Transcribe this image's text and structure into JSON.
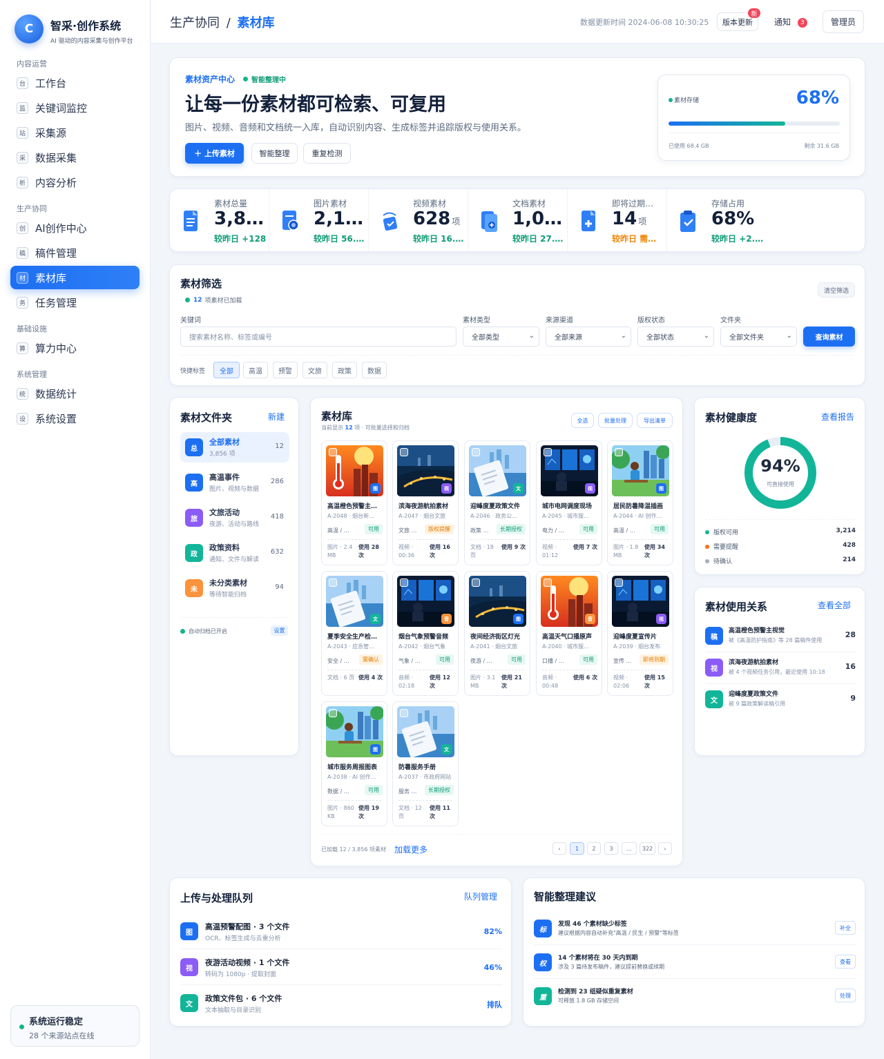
{
  "brand": {
    "logo": "C",
    "title": "智采·创作系统",
    "subtitle": "AI 驱动的内容采集与创作平台"
  },
  "nav": [
    {
      "group": "内容运营",
      "items": [
        {
          "icon": "台",
          "label": "工作台"
        },
        {
          "icon": "监",
          "label": "关键词监控"
        },
        {
          "icon": "站",
          "label": "采集源"
        },
        {
          "icon": "采",
          "label": "数据采集"
        },
        {
          "icon": "析",
          "label": "内容分析"
        }
      ]
    },
    {
      "group": "生产协同",
      "items": [
        {
          "icon": "创",
          "label": "AI创作中心"
        },
        {
          "icon": "稿",
          "label": "稿件管理"
        },
        {
          "icon": "材",
          "label": "素材库",
          "active": true
        },
        {
          "icon": "务",
          "label": "任务管理"
        }
      ]
    },
    {
      "group": "基础设施",
      "items": [
        {
          "icon": "算",
          "label": "算力中心"
        }
      ]
    },
    {
      "group": "系统管理",
      "items": [
        {
          "icon": "统",
          "label": "数据统计"
        },
        {
          "icon": "设",
          "label": "系统设置"
        }
      ]
    }
  ],
  "sys_status": {
    "title": "系统运行稳定",
    "subtitle": "28 个来源站点在线"
  },
  "topbar": {
    "crumb_parent": "生产协同",
    "crumb_sep": "/",
    "crumb_current": "素材库",
    "updated": "数据更新时间 2024-06-08 10:30:25",
    "version_btn": "版本更新",
    "version_badge": "新",
    "notify": "通知",
    "notify_count": "3",
    "admin": "管理员"
  },
  "hero": {
    "tag": "素材资产中心",
    "ai_tag": "智能整理中",
    "title": "让每一份素材都可检索、可复用",
    "desc": "图片、视频、音频和文档统一入库，自动识别内容、生成标签并追踪版权与使用关系。",
    "btn_upload": "＋ 上传素材",
    "btn_organize": "智能整理",
    "btn_dedup": "重复检测",
    "storage": {
      "label": "素材存储",
      "percent": "68%",
      "fill": 0.68,
      "used": "已使用 68.4 GB",
      "left": "剩余 31.6 GB"
    }
  },
  "stats": [
    {
      "label": "素材总量",
      "value": "3,8…",
      "unit": "",
      "delta": "较昨日 +128",
      "tone": "green",
      "icon": "doc"
    },
    {
      "label": "图片素材",
      "value": "2,1…",
      "unit": "",
      "delta": "较昨日 56.…",
      "tone": "green",
      "icon": "image"
    },
    {
      "label": "视频素材",
      "value": "628",
      "unit": "项",
      "delta": "较昨日 16.…",
      "tone": "green",
      "icon": "video"
    },
    {
      "label": "文档素材",
      "value": "1,0…",
      "unit": "",
      "delta": "较昨日 27.…",
      "tone": "green",
      "icon": "docs"
    },
    {
      "label": "即将过期…",
      "value": "14",
      "unit": "项",
      "delta": "较昨日 需…",
      "tone": "orange",
      "icon": "alert"
    },
    {
      "label": "存储占用",
      "value": "68%",
      "unit": "",
      "delta": "较昨日 +2.…",
      "tone": "green",
      "icon": "clipboard"
    }
  ],
  "filter": {
    "title": "素材筛选",
    "loaded_count": "12",
    "loaded_text": "项素材已加载",
    "clear": "清空筛选",
    "kw_label": "关键词",
    "kw_placeholder": "搜索素材名称、标签或编号",
    "type_label": "素材类型",
    "type_value": "全部类型",
    "src_label": "来源渠道",
    "src_value": "全部来源",
    "copy_label": "版权状态",
    "copy_value": "全部状态",
    "folder_label": "文件夹",
    "folder_value": "全部文件夹",
    "query": "查询素材",
    "quick_label": "快捷标签",
    "tags": [
      "全部",
      "高温",
      "预警",
      "文旅",
      "政策",
      "数据"
    ]
  },
  "folders": {
    "title": "素材文件夹",
    "new": "新建",
    "auto": "自动归档已开启",
    "settings": "设置",
    "items": [
      {
        "icon": "总",
        "name": "全部素材",
        "sub": "3,856 项",
        "count": "12",
        "color": "blue",
        "active": true
      },
      {
        "icon": "高",
        "name": "高温事件",
        "sub": "图片、视频与数据",
        "count": "286",
        "color": "blue"
      },
      {
        "icon": "旅",
        "name": "文旅活动",
        "sub": "夜游、活动与路线",
        "count": "418",
        "color": "purple"
      },
      {
        "icon": "政",
        "name": "政策资料",
        "sub": "通知、文件与解读",
        "count": "632",
        "color": "teal"
      },
      {
        "icon": "未",
        "name": "未分类素材",
        "sub": "等待智能归档",
        "count": "94",
        "color": "orange2"
      }
    ]
  },
  "library": {
    "title": "素材库",
    "subtitle_pre": "当前显示",
    "subtitle_count": "12",
    "subtitle_post": "项 · 可批量选择和归档",
    "select_all": "全选",
    "batch": "批量处理",
    "export": "导出清单",
    "loaded": "已加载 12 / 3,856 项素材",
    "load_more": "加载更多",
    "pages": [
      "‹",
      "1",
      "2",
      "3",
      "…",
      "322",
      "›"
    ],
    "items": [
      {
        "thumb": "heat",
        "type": "图",
        "type_color": "blue",
        "name": "高温橙色预警主…",
        "id": "A-2048 · 烟台新…",
        "cat": "高温 / 预警",
        "status": "可用",
        "st": "ok",
        "meta": "图片 · 2.4 MB",
        "use": "使用 28 次"
      },
      {
        "thumb": "night",
        "type": "视",
        "type_color": "purple",
        "name": "滨海夜游航拍素材",
        "id": "A-2047 · 烟台文旅",
        "cat": "文旅 …",
        "status": "版权提醒",
        "st": "warn",
        "meta": "视频 · 00:36",
        "use": "使用 16 次"
      },
      {
        "thumb": "doc",
        "type": "文",
        "type_color": "teal",
        "name": "迎峰度夏政策文件",
        "id": "A-2046 · 政务公…",
        "cat": "政策 …",
        "status": "长期授权",
        "st": "long",
        "meta": "文档 · 18 页",
        "use": "使用 9 次"
      },
      {
        "thumb": "control",
        "type": "视",
        "type_color": "purple",
        "name": "城市电网调度现场",
        "id": "A-2045 · 城市服…",
        "cat": "电力 / 现场",
        "status": "可用",
        "st": "ok",
        "meta": "视频 · 01:12",
        "use": "使用 7 次"
      },
      {
        "thumb": "park",
        "type": "图",
        "type_color": "blue",
        "name": "居民防暑降温插画",
        "id": "A-2044 · AI 创作…",
        "cat": "高温 / 民生",
        "status": "可用",
        "st": "ok",
        "meta": "图片 · 1.8 MB",
        "use": "使用 34 次"
      },
      {
        "thumb": "doc",
        "type": "文",
        "type_color": "teal",
        "name": "夏季安全生产检…",
        "id": "A-2043 · 应急管…",
        "cat": "安全 / …",
        "status": "需确认",
        "st": "warn",
        "meta": "文档 · 6 页",
        "use": "使用 4 次"
      },
      {
        "thumb": "control",
        "type": "音",
        "type_color": "orange2",
        "name": "烟台气象预警音频",
        "id": "A-2042 · 烟台气象",
        "cat": "气象 / 预警",
        "status": "可用",
        "st": "ok",
        "meta": "音频 · 02:18",
        "use": "使用 12 次"
      },
      {
        "thumb": "night",
        "type": "图",
        "type_color": "blue",
        "name": "夜间经济街区灯光",
        "id": "A-2041 · 烟台文旅",
        "cat": "夜游 / 城市",
        "status": "可用",
        "st": "ok",
        "meta": "图片 · 3.1 MB",
        "use": "使用 21 次"
      },
      {
        "thumb": "heat",
        "type": "音",
        "type_color": "orange2",
        "name": "高温天气口播原声",
        "id": "A-2040 · 城市服…",
        "cat": "口播 / 高温",
        "status": "可用",
        "st": "ok",
        "meta": "音频 · 00:48",
        "use": "使用 6 次"
      },
      {
        "thumb": "control",
        "type": "视",
        "type_color": "purple",
        "name": "迎峰度夏宣传片",
        "id": "A-2039 · 烟台发布",
        "cat": "宣传 …",
        "status": "即将到期",
        "st": "warn",
        "meta": "视频 · 02:06",
        "use": "使用 15 次"
      },
      {
        "thumb": "park",
        "type": "图",
        "type_color": "blue",
        "name": "城市服务周报图表",
        "id": "A-2038 · AI 创作…",
        "cat": "数据 / 周报",
        "status": "可用",
        "st": "ok",
        "meta": "图片 · 860 KB",
        "use": "使用 19 次"
      },
      {
        "thumb": "doc",
        "type": "文",
        "type_color": "teal",
        "name": "防暑服务手册",
        "id": "A-2037 · 市政府网站",
        "cat": "服务 …",
        "status": "长期授权",
        "st": "long",
        "meta": "文档 · 12 页",
        "use": "使用 11 次"
      }
    ]
  },
  "health": {
    "title": "素材健康度",
    "link": "查看报告",
    "percent": "94%",
    "fraction": 0.94,
    "caption": "可直接使用",
    "legend": [
      {
        "label": "版权可用",
        "value": "3,214",
        "color": "#13b599"
      },
      {
        "label": "需要提醒",
        "value": "428",
        "color": "#f97316"
      },
      {
        "label": "待确认",
        "value": "214",
        "color": "#a3adbd"
      }
    ]
  },
  "relations": {
    "title": "素材使用关系",
    "link": "查看全部",
    "items": [
      {
        "icon": "稿",
        "color": "blue",
        "title": "高温橙色预警主视觉",
        "sub": "被《高温防护指南》等 28 篇稿件使用",
        "count": "28"
      },
      {
        "icon": "视",
        "color": "purple",
        "title": "滨海夜游航拍素材",
        "sub": "被 4 个视频任务引用，最近使用 10:18",
        "count": "16"
      },
      {
        "icon": "文",
        "color": "teal",
        "title": "迎峰度夏政策文件",
        "sub": "被 9 篇政策解读稿引用",
        "count": "9"
      }
    ]
  },
  "queue": {
    "title": "上传与处理队列",
    "link": "队列管理",
    "items": [
      {
        "icon": "图",
        "color": "blue",
        "title": "高温预警配图 · 3 个文件",
        "sub": "OCR、标签生成与去重分析",
        "progress": "82%"
      },
      {
        "icon": "视",
        "color": "purple",
        "title": "夜游活动视频 · 1 个文件",
        "sub": "转码为 1080p · 提取封面",
        "progress": "46%"
      },
      {
        "icon": "文",
        "color": "teal",
        "title": "政策文件包 · 6 个文件",
        "sub": "文本抽取与目录识别",
        "progress": "排队"
      }
    ]
  },
  "suggest": {
    "title": "智能整理建议",
    "items": [
      {
        "icon": "标",
        "color": "blue",
        "title": "发现 46 个素材缺少标签",
        "sub": "建议根据内容自动补充\"高温 / 民生 / 预警\"等标签",
        "btn": "补全"
      },
      {
        "icon": "权",
        "color": "blue",
        "title": "14 个素材将在 30 天内到期",
        "sub": "涉及 3 篇待发布稿件，建议提前替换或续期",
        "btn": "查看"
      },
      {
        "icon": "重",
        "color": "teal",
        "title": "检测到 23 组疑似重复素材",
        "sub": "可释放 1.8 GB 存储空间",
        "btn": "处理"
      }
    ]
  }
}
